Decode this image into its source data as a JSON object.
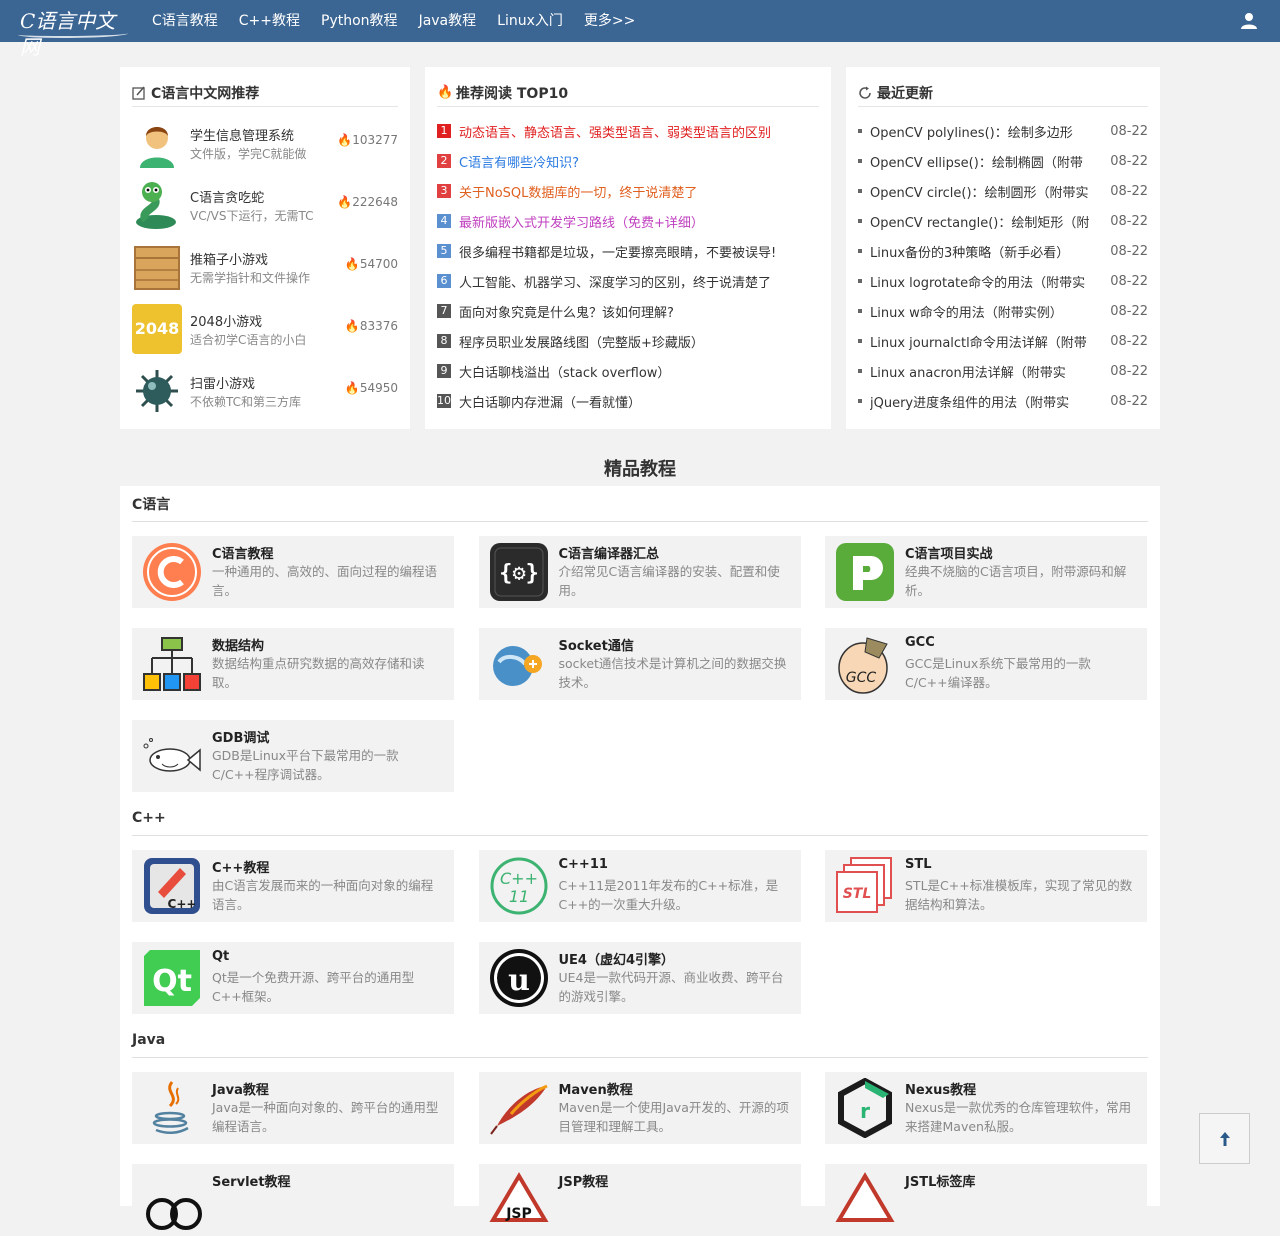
{
  "nav": {
    "logo": "C语言中文网",
    "links": [
      "C语言教程",
      "C++教程",
      "Python教程",
      "Java教程",
      "Linux入门",
      "更多>>"
    ]
  },
  "recommend": {
    "title": "C语言中文网推荐",
    "items": [
      {
        "name": "学生信息管理系统",
        "desc": "文件版，学完C就能做",
        "count": "103277"
      },
      {
        "name": "C语言贪吃蛇",
        "desc": "VC/VS下运行，无需TC",
        "count": "222648"
      },
      {
        "name": "推箱子小游戏",
        "desc": "无需学指针和文件操作",
        "count": "54700"
      },
      {
        "name": "2048小游戏",
        "desc": "适合初学C语言的小白",
        "count": "83376"
      },
      {
        "name": "扫雷小游戏",
        "desc": "不依赖TC和第三方库",
        "count": "54950"
      }
    ],
    "thumb_2048": "2048"
  },
  "top10": {
    "title": "推荐阅读 TOP10",
    "items": [
      {
        "num": "1",
        "text": "动态语言、静态语言、强类型语言、弱类型语言的区别",
        "color": "#e02020",
        "badge": "#e02020"
      },
      {
        "num": "2",
        "text": "C语言有哪些冷知识?",
        "color": "#2a7ae2",
        "badge": "#e04040"
      },
      {
        "num": "3",
        "text": "关于NoSQL数据库的一切，终于说清楚了",
        "color": "#e06020",
        "badge": "#e04040"
      },
      {
        "num": "4",
        "text": "最新版嵌入式开发学习路线（免费+详细）",
        "color": "#c040c0",
        "badge": "#5a8fd0"
      },
      {
        "num": "5",
        "text": "很多编程书籍都是垃圾，一定要擦亮眼睛，不要被误导!",
        "color": "#333333",
        "badge": "#5a8fd0"
      },
      {
        "num": "6",
        "text": "人工智能、机器学习、深度学习的区别，终于说清楚了",
        "color": "#333333",
        "badge": "#5a8fd0"
      },
      {
        "num": "7",
        "text": "面向对象究竟是什么鬼？该如何理解?",
        "color": "#333333",
        "badge": "#555555"
      },
      {
        "num": "8",
        "text": "程序员职业发展路线图（完整版+珍藏版）",
        "color": "#333333",
        "badge": "#555555"
      },
      {
        "num": "9",
        "text": "大白话聊栈溢出（stack overflow）",
        "color": "#333333",
        "badge": "#555555"
      },
      {
        "num": "10",
        "text": "大白话聊内存泄漏（一看就懂）",
        "color": "#333333",
        "badge": "#555555"
      }
    ]
  },
  "recent": {
    "title": "最近更新",
    "items": [
      {
        "text": "OpenCV polylines()：绘制多边形",
        "date": "08-22"
      },
      {
        "text": "OpenCV ellipse()：绘制椭圆（附带",
        "date": "08-22"
      },
      {
        "text": "OpenCV circle()：绘制圆形（附带实",
        "date": "08-22"
      },
      {
        "text": "OpenCV rectangle()：绘制矩形（附",
        "date": "08-22"
      },
      {
        "text": "Linux备份的3种策略（新手必看）",
        "date": "08-22"
      },
      {
        "text": "Linux logrotate命令的用法（附带实",
        "date": "08-22"
      },
      {
        "text": "Linux w命令的用法（附带实例）",
        "date": "08-22"
      },
      {
        "text": "Linux journalctl命令用法详解（附带",
        "date": "08-22"
      },
      {
        "text": "Linux anacron用法详解（附带实",
        "date": "08-22"
      },
      {
        "text": "jQuery进度条组件的用法（附带实",
        "date": "08-22"
      }
    ]
  },
  "section_title": "精品教程",
  "categories": [
    {
      "name": "C语言",
      "cards": [
        {
          "title": "C语言教程",
          "desc": "一种通用的、高效的、面向过程的编程语言。",
          "icon": "c-logo-icon"
        },
        {
          "title": "C语言编译器汇总",
          "desc": "介绍常见C语言编译器的安装、配置和使用。",
          "icon": "compiler-icon"
        },
        {
          "title": "C语言项目实战",
          "desc": "经典不烧脑的C语言项目，附带源码和解析。",
          "icon": "project-icon"
        },
        {
          "title": "数据结构",
          "desc": "数据结构重点研究数据的高效存储和读取。",
          "icon": "data-structure-icon"
        },
        {
          "title": "Socket通信",
          "desc": "socket通信技术是计算机之间的数据交换技术。",
          "icon": "socket-icon"
        },
        {
          "title": "GCC",
          "desc": "GCC是Linux系统下最常用的一款C/C++编译器。",
          "icon": "gcc-icon",
          "icon_text": "GCC"
        },
        {
          "title": "GDB调试",
          "desc": "GDB是Linux平台下最常用的一款C/C++程序调试器。",
          "icon": "gdb-fish-icon"
        }
      ]
    },
    {
      "name": "C++",
      "cards": [
        {
          "title": "C++教程",
          "desc": "由C语言发展而来的一种面向对象的编程语言。",
          "icon": "cpp-icon",
          "icon_text": "C++"
        },
        {
          "title": "C++11",
          "desc": "C++11是2011年发布的C++标准，是C++的一次重大升级。",
          "icon": "cpp11-icon",
          "icon_text": "C++ 11"
        },
        {
          "title": "STL",
          "desc": "STL是C++标准模板库，实现了常见的数据结构和算法。",
          "icon": "stl-icon",
          "icon_text": "STL"
        },
        {
          "title": "Qt",
          "desc": "Qt是一个免费开源、跨平台的通用型C++框架。",
          "icon": "qt-icon",
          "icon_text": "Qt"
        },
        {
          "title": "UE4（虚幻4引擎）",
          "desc": "UE4是一款代码开源、商业收费、跨平台的游戏引擎。",
          "icon": "unreal-icon"
        }
      ]
    },
    {
      "name": "Java",
      "cards": [
        {
          "title": "Java教程",
          "desc": "Java是一种面向对象的、跨平台的通用型编程语言。",
          "icon": "java-icon"
        },
        {
          "title": "Maven教程",
          "desc": "Maven是一个使用Java开发的、开源的项目管理和理解工具。",
          "icon": "maven-feather-icon"
        },
        {
          "title": "Nexus教程",
          "desc": "Nexus是一款优秀的仓库管理软件，常用来搭建Maven私服。",
          "icon": "nexus-icon",
          "icon_text": "r"
        },
        {
          "title": "Servlet教程",
          "desc": "",
          "icon": "servlet-icon"
        },
        {
          "title": "JSP教程",
          "desc": "",
          "icon": "jsp-icon",
          "icon_text": "JSP"
        },
        {
          "title": "JSTL标签库",
          "desc": "",
          "icon": "jstl-icon"
        }
      ]
    }
  ],
  "colors": {
    "nav": "#3b6593",
    "accent": "#e02020"
  }
}
